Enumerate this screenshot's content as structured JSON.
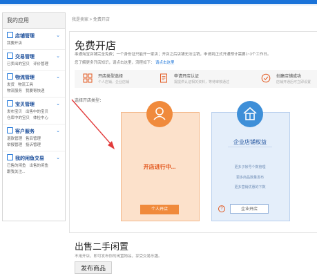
{
  "sidebar": {
    "title": "我的应用",
    "groups": [
      {
        "title": "店铺管理",
        "links": [
          "我要开店"
        ]
      },
      {
        "title": "交易管理",
        "links": [
          "已卖出的宝贝",
          "评价管理"
        ]
      },
      {
        "title": "物流管理",
        "links": [
          "发货",
          "物流工具",
          "物流服务",
          "我要寄快递"
        ]
      },
      {
        "title": "宝贝管理",
        "links": [
          "发布宝贝",
          "出售中的宝贝",
          "仓库中的宝贝",
          "体检中心"
        ]
      },
      {
        "title": "客户服务",
        "links": [
          "退款管理",
          "售后管理",
          "举报管理",
          "投诉管理"
        ]
      },
      {
        "title": "我的闲鱼交易",
        "links": [
          "已售的闲鱼",
          "出售的闲鱼",
          "跟我关注..."
        ]
      }
    ]
  },
  "breadcrumb": "我是卖家 > 免费开店",
  "main": {
    "title": "免费开店",
    "desc1": "串通淘宝店铺完全免费；一个身份证只能开一家店；开店之后店铺无法注销，申请到正式开通预计需要1~3个工作日。",
    "desc2_text": "您了解更多开店知识，请点击这里，流程如下：",
    "desc2_link": "请点击这里",
    "steps": [
      {
        "icon": "store-type-icon",
        "title": "开店类型选择",
        "sub": "个人店铺，企业店铺"
      },
      {
        "icon": "document-icon",
        "title": "申请开店认证",
        "sub": "需提供认证相关资料，等待审核通过"
      },
      {
        "icon": "check-circle-icon",
        "title": "创建店铺成功",
        "sub": "店铺开通后可立即设置"
      }
    ],
    "choose_label": "选择开店类型：",
    "personal": {
      "status": "开店进行中...",
      "button": "个人开店"
    },
    "enterprise": {
      "title": "企业店铺权益",
      "links": [
        "更多子帐号个数管理",
        "更多商品数量发布",
        "更多营销优惠的下数"
      ],
      "help": "?",
      "button": "企业开店"
    }
  },
  "second": {
    "title": "出售二手闲置",
    "desc": "不用开店，即可发布你的闲置物品，享受交易乐趣。",
    "button": "发布商品"
  },
  "colors": {
    "accent": "#1a73d9",
    "orange": "#f08a3c",
    "blue": "#3e8fd8",
    "red_arrow": "#e23b3b"
  }
}
